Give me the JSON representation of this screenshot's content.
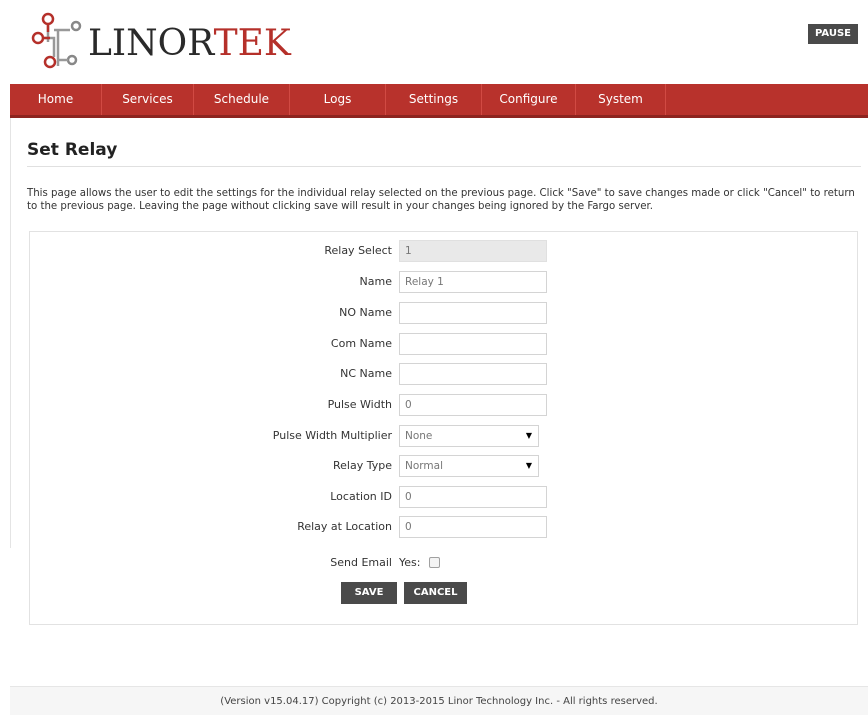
{
  "header": {
    "brand_part1": "LINOR",
    "brand_part2": "TEK",
    "pause_label": "PAUSE"
  },
  "nav": {
    "items": [
      {
        "label": "Home"
      },
      {
        "label": "Services"
      },
      {
        "label": "Schedule"
      },
      {
        "label": "Logs"
      },
      {
        "label": "Settings"
      },
      {
        "label": "Configure"
      },
      {
        "label": "System"
      }
    ]
  },
  "page": {
    "title": "Set Relay",
    "description": "This page allows the user to edit the settings for the individual relay selected on the previous page. Click \"Save\" to save changes made or click \"Cancel\" to return to the previous page. Leaving the page without clicking save will result in your changes being ignored by the Fargo server."
  },
  "form": {
    "relay_select": {
      "label": "Relay Select",
      "value": "1"
    },
    "name": {
      "label": "Name",
      "value": "Relay 1"
    },
    "no_name": {
      "label": "NO Name",
      "value": ""
    },
    "com_name": {
      "label": "Com Name",
      "value": ""
    },
    "nc_name": {
      "label": "NC Name",
      "value": ""
    },
    "pulse_width": {
      "label": "Pulse Width",
      "value": "0"
    },
    "pulse_width_multiplier": {
      "label": "Pulse Width Multiplier",
      "value": "None"
    },
    "relay_type": {
      "label": "Relay Type",
      "value": "Normal"
    },
    "location_id": {
      "label": "Location ID",
      "value": "0"
    },
    "relay_at_location": {
      "label": "Relay at Location",
      "value": "0"
    },
    "send_email": {
      "label": "Send Email",
      "option_label": "Yes:",
      "checked": false
    },
    "save_label": "SAVE",
    "cancel_label": "CANCEL"
  },
  "footer": {
    "text": "(Version v15.04.17) Copyright (c) 2013-2015 Linor Technology Inc. - All rights reserved."
  },
  "colors": {
    "nav_red": "#b8322c",
    "brand_red": "#b5302a",
    "button_dark": "#4a4a4a"
  }
}
